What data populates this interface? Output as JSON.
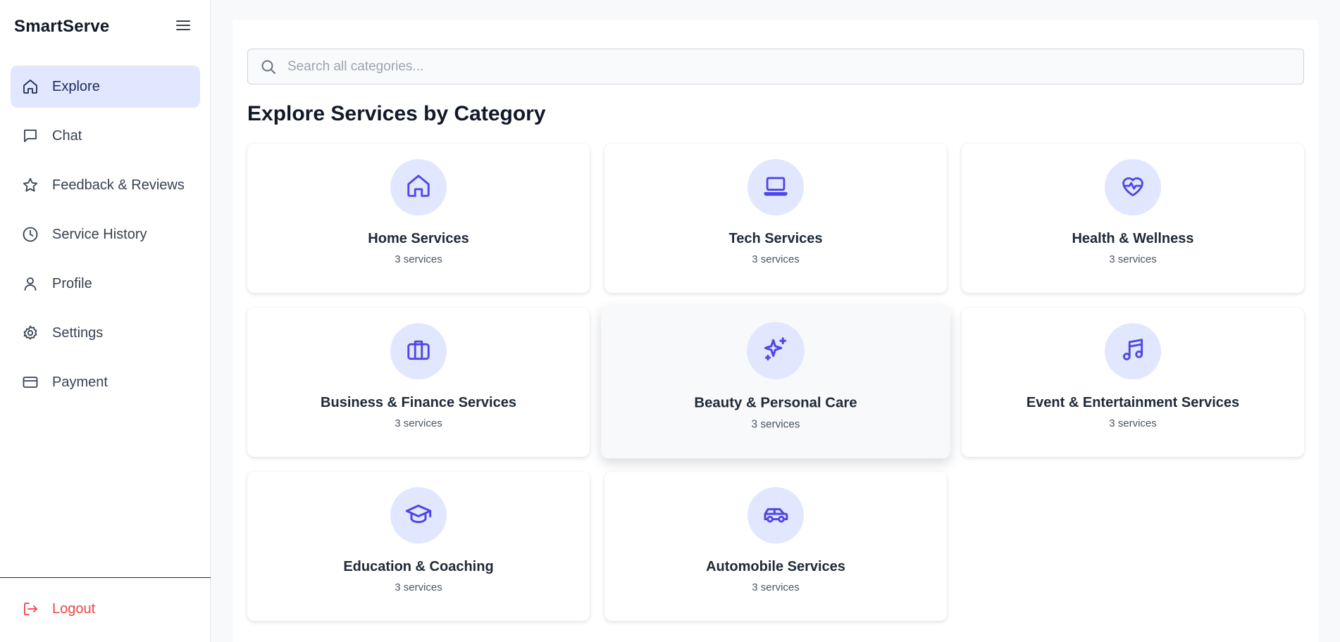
{
  "app": {
    "brand": "SmartServe"
  },
  "sidebar": {
    "items": [
      {
        "label": "Explore",
        "icon": "home-icon"
      },
      {
        "label": "Chat",
        "icon": "chat-icon"
      },
      {
        "label": "Feedback & Reviews",
        "icon": "star-icon"
      },
      {
        "label": "Service History",
        "icon": "clock-icon"
      },
      {
        "label": "Profile",
        "icon": "user-icon"
      },
      {
        "label": "Settings",
        "icon": "gear-icon"
      },
      {
        "label": "Payment",
        "icon": "credit-card-icon"
      }
    ],
    "active_index": 0,
    "logout_label": "Logout"
  },
  "search": {
    "placeholder": "Search all categories...",
    "value": ""
  },
  "main": {
    "heading": "Explore Services by Category",
    "categories": [
      {
        "title": "Home Services",
        "count": "3 services",
        "icon": "home-icon"
      },
      {
        "title": "Tech Services",
        "count": "3 services",
        "icon": "laptop-icon"
      },
      {
        "title": "Health & Wellness",
        "count": "3 services",
        "icon": "heart-pulse-icon"
      },
      {
        "title": "Business & Finance Services",
        "count": "3 services",
        "icon": "briefcase-icon"
      },
      {
        "title": "Beauty & Personal Care",
        "count": "3 services",
        "icon": "sparkles-icon"
      },
      {
        "title": "Event & Entertainment Services",
        "count": "3 services",
        "icon": "music-note-icon"
      },
      {
        "title": "Education & Coaching",
        "count": "3 services",
        "icon": "graduation-cap-icon"
      },
      {
        "title": "Automobile Services",
        "count": "3 services",
        "icon": "car-icon"
      }
    ]
  },
  "colors": {
    "accent": "#4f46e5",
    "active_bg": "#e0e7ff",
    "logout": "#ef4444",
    "page_bg": "#f8f9fb"
  }
}
